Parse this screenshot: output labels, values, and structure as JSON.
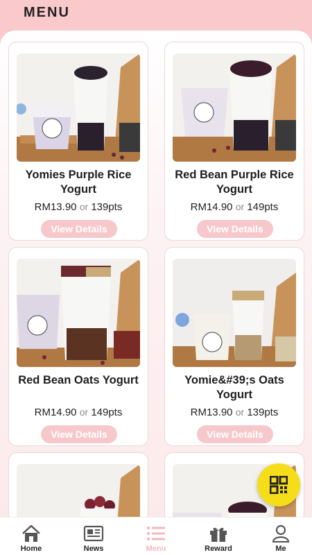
{
  "header": {
    "title": "MENU"
  },
  "products": [
    {
      "name": "Yomies Purple Rice Yogurt",
      "price": "RM13.90",
      "or": "or",
      "points": "139pts",
      "button": "View Details"
    },
    {
      "name": "Red Bean Purple Rice Yogurt",
      "price": "RM14.90",
      "or": "or",
      "points": "149pts",
      "button": "View Details"
    },
    {
      "name": "Red Bean Oats Yogurt",
      "price": "RM14.90",
      "or": "or",
      "points": "149pts",
      "button": "View Details"
    },
    {
      "name": "Yomie&#39;s Oats Yogurt",
      "price": "RM13.90",
      "or": "or",
      "points": "139pts",
      "button": "View Details"
    }
  ],
  "nav": {
    "items": [
      {
        "label": "Home",
        "icon": "home-icon"
      },
      {
        "label": "News",
        "icon": "news-icon"
      },
      {
        "label": "Menu",
        "icon": "menu-list-icon",
        "active": true
      },
      {
        "label": "Reward",
        "icon": "gift-icon"
      },
      {
        "label": "Me",
        "icon": "user-icon"
      }
    ]
  },
  "colors": {
    "header_bg": "#f9c9cc",
    "accent": "#f7c8cb",
    "fab": "#f5dd1a",
    "active_nav": "#f7b6bb"
  }
}
